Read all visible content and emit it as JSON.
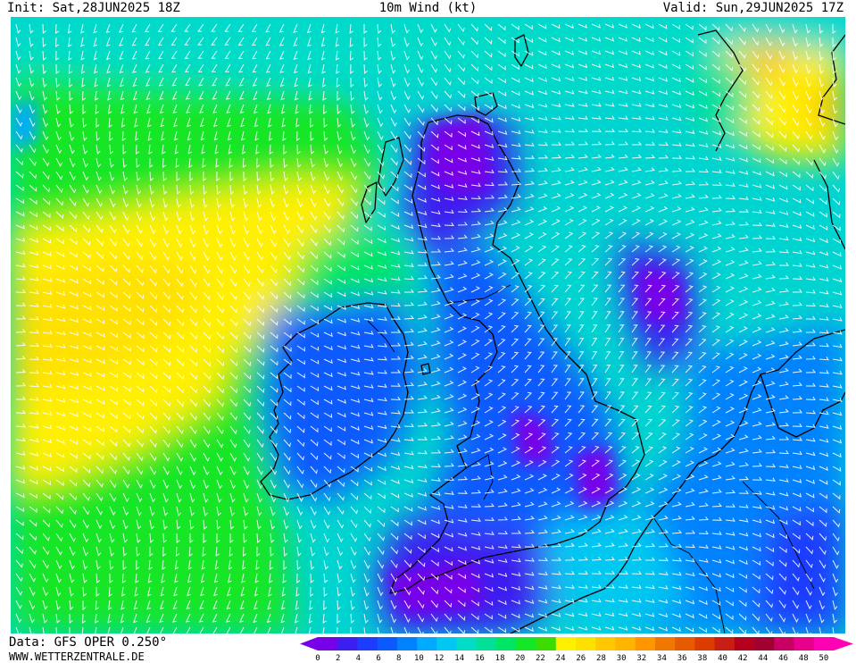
{
  "header": {
    "init": "Init: Sat,28JUN2025 18Z",
    "title": "10m Wind (kt)",
    "valid": "Valid: Sun,29JUN2025 17Z"
  },
  "footer": {
    "data_source": "Data: GFS OPER 0.250°",
    "website": "WWW.WETTERZENTRALE.DE"
  },
  "legend": {
    "ticks": [
      "0",
      "2",
      "4",
      "6",
      "8",
      "10",
      "12",
      "14",
      "16",
      "18",
      "20",
      "22",
      "24",
      "26",
      "28",
      "30",
      "32",
      "34",
      "36",
      "38",
      "40",
      "42",
      "44",
      "46",
      "48",
      "50"
    ],
    "colors": [
      "#7800e8",
      "#3c1ef0",
      "#1e3cff",
      "#0a5aff",
      "#0082ff",
      "#00aaff",
      "#00c8f0",
      "#00dcc8",
      "#00e096",
      "#00e664",
      "#14e628",
      "#3cdc00",
      "#fff000",
      "#ffe100",
      "#ffc800",
      "#ffb400",
      "#ff9600",
      "#f07800",
      "#e65a00",
      "#dc3c00",
      "#c81e14",
      "#b4001e",
      "#a00032",
      "#c80064",
      "#e6008c",
      "#ff00b4"
    ]
  }
}
